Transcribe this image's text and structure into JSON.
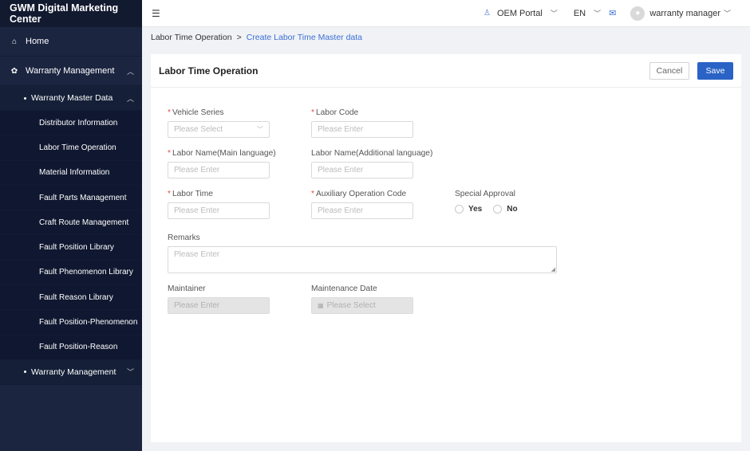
{
  "app": {
    "title": "GWM Digital Marketing Center"
  },
  "sidebar": {
    "home": "Home",
    "warranty_management": "Warranty Management",
    "warranty_master_data": "Warranty Master Data",
    "leaves": [
      "Distributor Information",
      "Labor Time Operation",
      "Material Information",
      "Fault Parts Management",
      "Craft Route Management",
      "Fault Position Library",
      "Fault Phenomenon Library",
      "Fault Reason Library",
      "Fault Position-Phenomenon",
      "Fault Position-Reason"
    ],
    "warranty_management_sub": "Warranty Management"
  },
  "topbar": {
    "portal": "OEM Portal",
    "language": "EN",
    "user": "warranty manager"
  },
  "breadcrumb": {
    "parent": "Labor Time Operation",
    "separator": ">",
    "current": "Create Labor Time Master data"
  },
  "panel": {
    "title": "Labor Time Operation",
    "cancel_label": "Cancel",
    "save_label": "Save"
  },
  "form": {
    "vehicle_series": {
      "label": "Vehicle Series",
      "placeholder": "Please Select"
    },
    "labor_code": {
      "label": "Labor Code",
      "placeholder": "Please Enter"
    },
    "labor_name_main": {
      "label": "Labor Name(Main language)",
      "placeholder": "Please Enter"
    },
    "labor_name_additional": {
      "label": "Labor Name(Additional language)",
      "placeholder": "Please Enter"
    },
    "labor_time": {
      "label": "Labor Time",
      "placeholder": "Please Enter"
    },
    "auxiliary_operation_code": {
      "label": "Auxiliary Operation Code",
      "placeholder": "Please Enter"
    },
    "special_approval": {
      "label": "Special Approval",
      "yes": "Yes",
      "no": "No"
    },
    "remarks": {
      "label": "Remarks",
      "placeholder": "Please Enter"
    },
    "maintainer": {
      "label": "Maintainer",
      "placeholder": "Please Enter"
    },
    "maintenance_date": {
      "label": "Maintenance Date",
      "placeholder": "Please Select"
    },
    "required_mark": "*"
  },
  "colors": {
    "sidebar_bg": "#1b2540",
    "accent": "#2a63c5",
    "link": "#3b6fd6",
    "required": "#e64a3c"
  },
  "icons": [
    "home-icon",
    "gear-icon",
    "hamburger-icon",
    "user-icon",
    "chevron-down-icon",
    "mail-icon",
    "avatar-icon",
    "calendar-icon"
  ]
}
